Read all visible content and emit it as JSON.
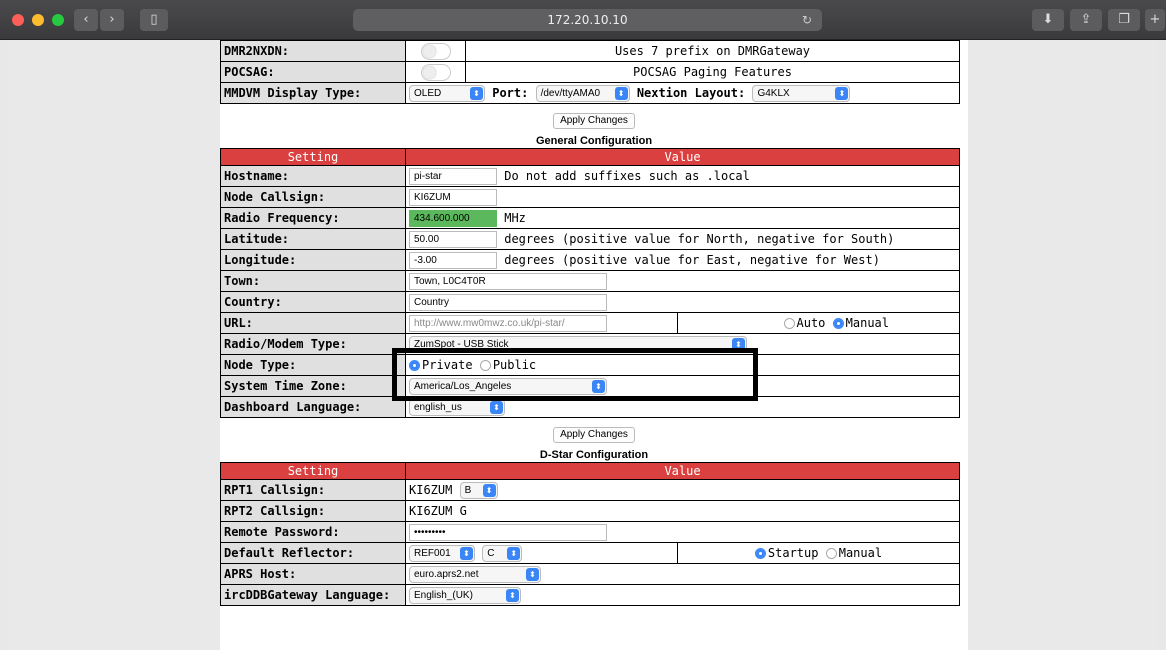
{
  "browser": {
    "url": "172.20.10.10",
    "reload_glyph": "↻"
  },
  "mmdvm": {
    "rows": [
      {
        "label": "DMR2NXDN:",
        "desc": "Uses 7 prefix on DMRGateway"
      },
      {
        "label": "POCSAG:",
        "desc": "POCSAG Paging Features"
      }
    ],
    "display": {
      "label": "MMDVM Display Type:",
      "type": "OLED",
      "port_label": "Port:",
      "port": "/dev/ttyAMA0",
      "nextion_label": "Nextion Layout:",
      "nextion": "G4KLX"
    },
    "apply": "Apply Changes"
  },
  "general": {
    "title": "General Configuration",
    "headers": {
      "setting": "Setting",
      "value": "Value"
    },
    "hostname": {
      "label": "Hostname:",
      "value": "pi-star",
      "hint": "Do not add suffixes such as .local"
    },
    "callsign": {
      "label": "Node Callsign:",
      "value": "KI6ZUM"
    },
    "frequency": {
      "label": "Radio Frequency:",
      "value": "434.600.000",
      "unit": "MHz",
      "highlight_color": "#5cb85c"
    },
    "latitude": {
      "label": "Latitude:",
      "value": "50.00",
      "hint": "degrees (positive value for North, negative for South)"
    },
    "longitude": {
      "label": "Longitude:",
      "value": "-3.00",
      "hint": "degrees (positive value for East, negative for West)"
    },
    "town": {
      "label": "Town:",
      "value": "Town, L0C4T0R"
    },
    "country": {
      "label": "Country:",
      "value": "Country"
    },
    "url": {
      "label": "URL:",
      "value": "http://www.mw0mwz.co.uk/pi-star/",
      "auto": "Auto",
      "manual": "Manual"
    },
    "modem": {
      "label": "Radio/Modem Type:",
      "value": "ZumSpot - USB Stick"
    },
    "nodetype": {
      "label": "Node Type:",
      "private": "Private",
      "public": "Public"
    },
    "timezone": {
      "label": "System Time Zone:",
      "value": "America/Los_Angeles"
    },
    "language": {
      "label": "Dashboard Language:",
      "value": "english_us"
    },
    "apply": "Apply Changes"
  },
  "dstar": {
    "title": "D-Star Configuration",
    "headers": {
      "setting": "Setting",
      "value": "Value"
    },
    "rpt1": {
      "label": "RPT1 Callsign:",
      "value": "KI6ZUM",
      "module": "B"
    },
    "rpt2": {
      "label": "RPT2 Callsign:",
      "value": "KI6ZUM G"
    },
    "password": {
      "label": "Remote Password:",
      "value": "•••••••••"
    },
    "reflector": {
      "label": "Default Reflector:",
      "value": "REF001",
      "module": "C",
      "startup": "Startup",
      "manual": "Manual"
    },
    "aprs": {
      "label": "APRS Host:",
      "value": "euro.aprs2.net"
    },
    "irclang": {
      "label": "ircDDBGateway Language:",
      "value": "English_(UK)"
    }
  }
}
